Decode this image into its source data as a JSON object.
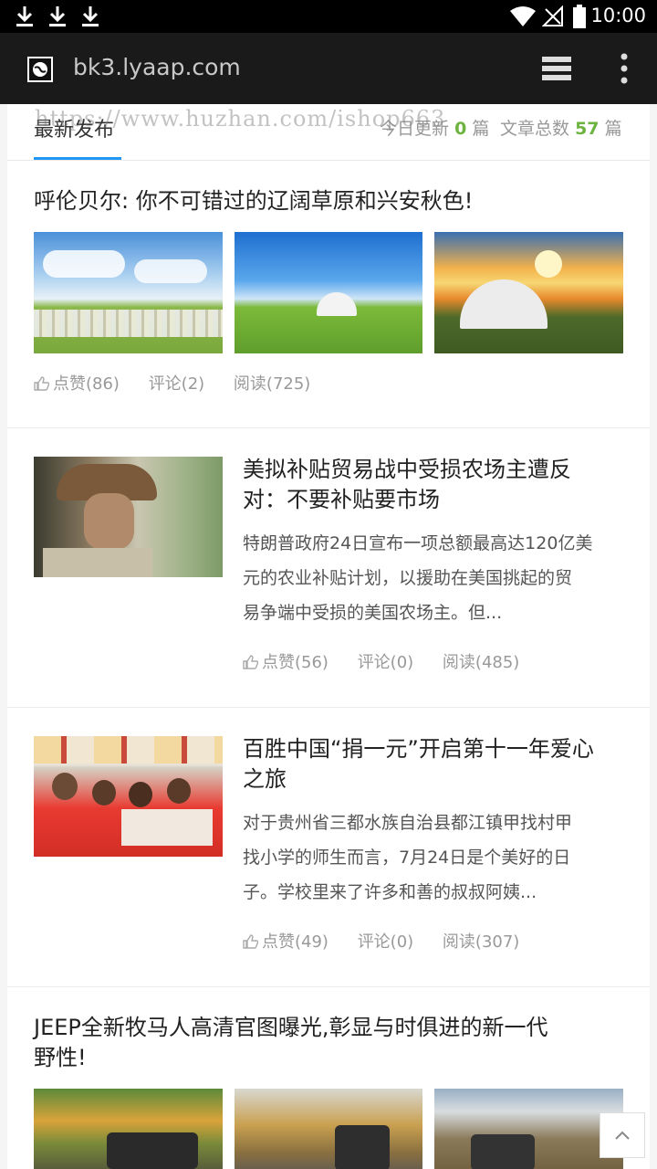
{
  "status_bar": {
    "time": "10:00"
  },
  "browser": {
    "url": "bk3.lyaap.com"
  },
  "tabs": {
    "latest_label": "最新发布",
    "today_label": "今日更新",
    "today_count": "0",
    "unit": "篇",
    "total_label": "文章总数",
    "total_count": "57"
  },
  "watermark": "https://www.huzhan.com/ishop663",
  "articles": [
    {
      "title": "呼伦贝尔: 你不可错过的辽阔草原和兴安秋色!",
      "likes": "点赞(86)",
      "comments": "评论(2)",
      "reads": "阅读(725)"
    },
    {
      "title_line1": "美拟补贴贸易战中受损农场主遭反",
      "title_line2": "对：不要补贴要市场",
      "summary_line1": "特朗普政府24日宣布一项总额最高达120亿美",
      "summary_line2": "元的农业补贴计划，以援助在美国挑起的贸",
      "summary_line3": "易争端中受损的美国农场主。但...",
      "likes": "点赞(56)",
      "comments": "评论(0)",
      "reads": "阅读(485)"
    },
    {
      "title_line1": "百胜中国“捐一元”开启第十一年爱心",
      "title_line2": "之旅",
      "summary_line1": "对于贵州省三都水族自治县都江镇甲找村甲",
      "summary_line2": "找小学的师生而言，7月24日是个美好的日",
      "summary_line3": "子。学校里来了许多和善的叔叔阿姨...",
      "likes": "点赞(49)",
      "comments": "评论(0)",
      "reads": "阅读(307)"
    },
    {
      "title_line1": "JEEP全新牧马人高清官图曝光,彰显与时俱进的新一代",
      "title_line2": "野性!"
    }
  ],
  "colors": {
    "accent": "#2196f3",
    "count": "#6db33f"
  }
}
